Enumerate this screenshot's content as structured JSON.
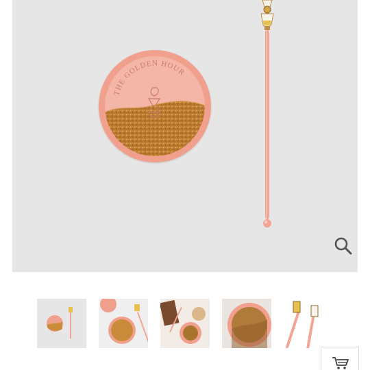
{
  "product": {
    "coaster_engraving": "THE GOLDEN HOUR",
    "colors": {
      "background": "#e6e6e6",
      "coaster": "#f1a08e",
      "coaster_inner": "#f4b6a6",
      "glitter": "#c98a3a",
      "stirrer": "#f2a594"
    }
  },
  "gallery": {
    "thumbnails": [
      {
        "name": "coaster-and-stirrer",
        "selected": true
      },
      {
        "name": "coaster-closeup-with-stirrer",
        "selected": false
      },
      {
        "name": "lifestyle-table-setting",
        "selected": false
      },
      {
        "name": "coaster-glitter-closeup",
        "selected": false
      },
      {
        "name": "stirrer-toppers-closeup",
        "selected": false
      }
    ]
  },
  "icons": {
    "zoom": "magnifier-icon",
    "cart": "shopping-cart-icon"
  }
}
